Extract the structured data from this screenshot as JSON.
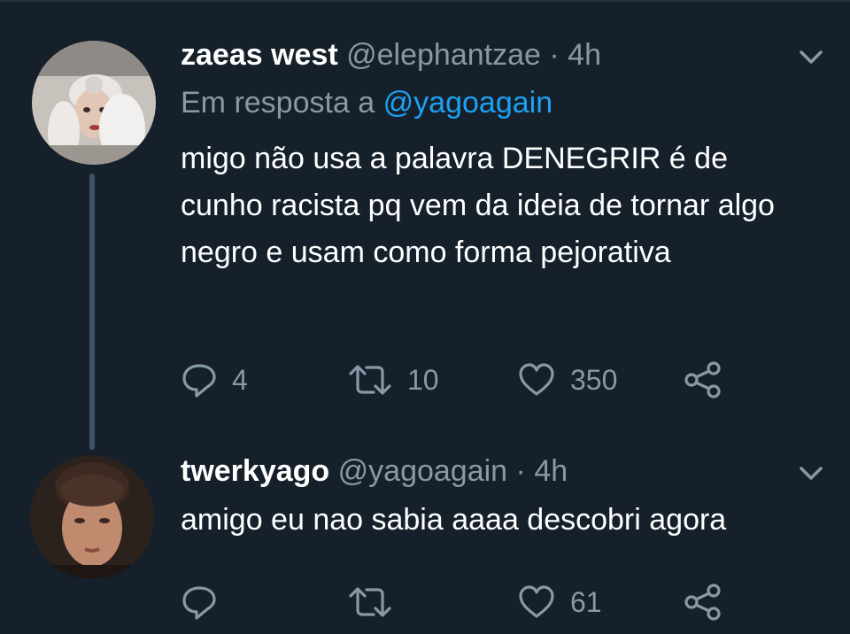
{
  "tweets": [
    {
      "name": "zaeas west",
      "handle": "@elephantzae",
      "separator": "·",
      "time": "4h",
      "reply_prefix": "Em resposta a",
      "reply_mention": "@yagoagain",
      "text": "migo não usa a palavra DENEGRIR é de cunho racista pq vem da ideia de tornar algo negro e usam como forma pejorativa",
      "replies": "4",
      "retweets": "10",
      "likes": "350"
    },
    {
      "name": "twerkyago",
      "handle": "@yagoagain",
      "separator": "·",
      "time": "4h",
      "text": "amigo eu nao sabia aaaa descobri agora",
      "replies": "",
      "retweets": "",
      "likes": "61"
    }
  ],
  "colors": {
    "background": "#15202b",
    "secondary_text": "#8899a6",
    "mention": "#1da1f2",
    "thread_line": "#3d5466"
  },
  "icons": [
    "reply-icon",
    "retweet-icon",
    "like-icon",
    "share-icon",
    "chevron-down-icon"
  ]
}
